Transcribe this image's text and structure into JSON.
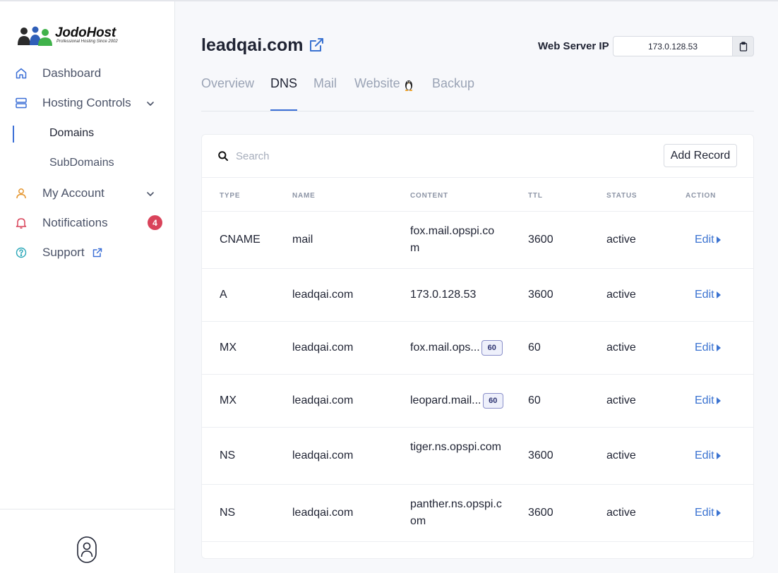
{
  "brand": {
    "name": "JodoHost",
    "tagline": "Professional Hosting Since 2002"
  },
  "sidebar": {
    "items": [
      {
        "label": "Dashboard",
        "icon": "home-icon"
      },
      {
        "label": "Hosting Controls",
        "icon": "server-icon",
        "expanded": true,
        "children": [
          {
            "label": "Domains",
            "active": true
          },
          {
            "label": "SubDomains"
          }
        ]
      },
      {
        "label": "My Account",
        "icon": "user-icon"
      },
      {
        "label": "Notifications",
        "icon": "bell-icon",
        "badge": "4"
      },
      {
        "label": "Support",
        "icon": "help-circle-icon"
      }
    ]
  },
  "header": {
    "title": "leadqai.com",
    "ip_label": "Web Server IP",
    "ip_value": "173.0.128.53"
  },
  "tabs": [
    {
      "label": "Overview"
    },
    {
      "label": "DNS",
      "active": true
    },
    {
      "label": "Mail"
    },
    {
      "label": "Website"
    },
    {
      "label": "Backup"
    }
  ],
  "search": {
    "placeholder": "Search"
  },
  "add_record_label": "Add Record",
  "table": {
    "columns": [
      "TYPE",
      "NAME",
      "CONTENT",
      "TTL",
      "STATUS",
      "ACTION"
    ],
    "rows": [
      {
        "type": "CNAME",
        "name": "mail",
        "content": "fox.mail.opspi.com",
        "ttl": "3600",
        "status": "active",
        "action": "Edit"
      },
      {
        "type": "A",
        "name": "leadqai.com",
        "content": "173.0.128.53",
        "ttl": "3600",
        "status": "active",
        "action": "Edit"
      },
      {
        "type": "MX",
        "name": "leadqai.com",
        "content": "fox.mail.ops...",
        "priority": "60",
        "ttl": "60",
        "status": "active",
        "action": "Edit"
      },
      {
        "type": "MX",
        "name": "leadqai.com",
        "content": "leopard.mail...",
        "priority": "60",
        "ttl": "60",
        "status": "active",
        "action": "Edit"
      },
      {
        "type": "NS",
        "name": "leadqai.com",
        "content": "tiger.ns.opspi.com",
        "ttl": "3600",
        "status": "active",
        "action": "Edit"
      },
      {
        "type": "NS",
        "name": "leadqai.com",
        "content": "panther.ns.opspi.com",
        "ttl": "3600",
        "status": "active",
        "action": "Edit"
      }
    ]
  },
  "colors": {
    "accent": "#3b6fd6",
    "badge": "#d9435a",
    "link": "#3b73d1",
    "nav_text": "#4b5368",
    "muted": "#9aa3b5"
  }
}
